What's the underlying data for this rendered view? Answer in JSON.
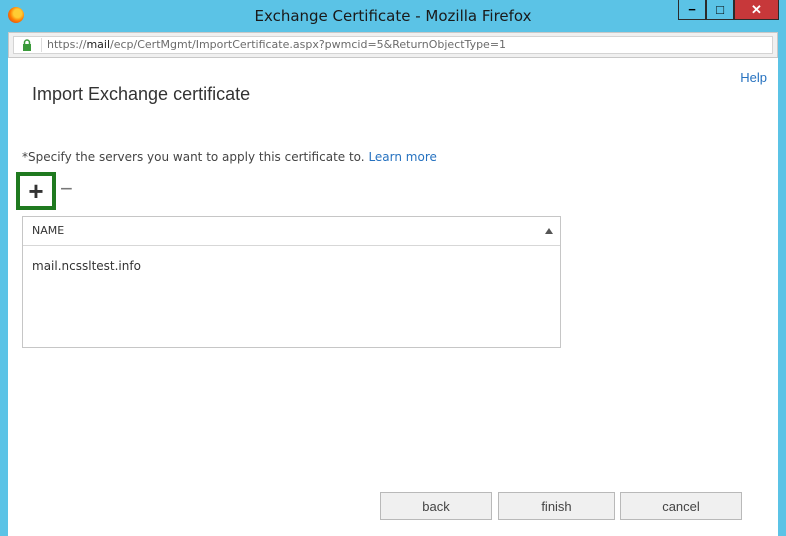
{
  "window": {
    "title": "Exchange Certificate - Mozilla Firefox",
    "minimize_label": "−",
    "maximize_label": "□",
    "close_label": "✕"
  },
  "browser": {
    "url_prefix": "https://",
    "url_host": "mail",
    "url_path": "/ecp/CertMgmt/ImportCertificate.aspx?pwmcid=5&ReturnObjectType=1"
  },
  "page": {
    "help_label": "Help",
    "title": "Import Exchange certificate",
    "instruction": "*Specify the servers you want to apply this certificate to.",
    "learn_more": "Learn more",
    "add_label": "+",
    "remove_label": "−"
  },
  "table": {
    "column_name": "NAME",
    "sort": "ascending",
    "rows": [
      "mail.ncssltest.info"
    ]
  },
  "footer": {
    "back": "back",
    "finish": "finish",
    "cancel": "cancel"
  },
  "colors": {
    "titlebar": "#5bc3e6",
    "close_button": "#c7383a",
    "link": "#2672c0",
    "highlight": "#1f7a1f"
  }
}
